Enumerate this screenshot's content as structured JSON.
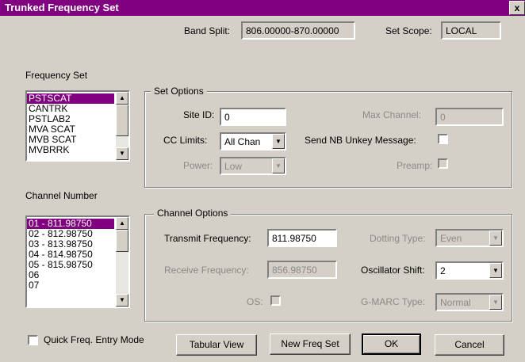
{
  "window": {
    "title": "Trunked Frequency Set",
    "close_glyph": "x"
  },
  "header": {
    "band_split_label": "Band Split:",
    "band_split_value": "806.00000-870.00000",
    "set_scope_label": "Set Scope:",
    "set_scope_value": "LOCAL"
  },
  "frequency_set": {
    "label": "Frequency Set",
    "items": [
      "PSTSCAT",
      "CANTRK",
      "PSTLAB2",
      "MVA SCAT",
      "MVB SCAT",
      "MVBRRK"
    ],
    "selected_index": 0
  },
  "set_options": {
    "label": "Set Options",
    "site_id_label": "Site ID:",
    "site_id_value": "0",
    "max_channel_label": "Max Channel:",
    "max_channel_value": "0",
    "cc_limits_label": "CC Limits:",
    "cc_limits_value": "All Chan",
    "send_nb_unkey_label": "Send NB Unkey Message:",
    "power_label": "Power:",
    "power_value": "Low",
    "preamp_label": "Preamp:"
  },
  "channel_number": {
    "label": "Channel Number",
    "items": [
      "01 - 811.98750",
      "02 - 812.98750",
      "03 - 813.98750",
      "04 - 814.98750",
      "05 - 815.98750",
      "06",
      "07"
    ],
    "selected_index": 0
  },
  "channel_options": {
    "label": "Channel Options",
    "transmit_label": "Transmit Frequency:",
    "transmit_value": "811.98750",
    "dotting_label": "Dotting Type:",
    "dotting_value": "Even",
    "receive_label": "Receive Frequency:",
    "receive_value": "856.98750",
    "oscillator_label": "Oscillator Shift:",
    "oscillator_value": "2",
    "os_label": "OS:",
    "gmarc_label": "G-MARC Type:",
    "gmarc_value": "Normal"
  },
  "footer": {
    "quick_entry_label": "Quick Freq. Entry Mode",
    "tabular_view_label": "Tabular View",
    "new_freq_set_label": "New Freq Set",
    "ok_label": "OK",
    "cancel_label": "Cancel"
  },
  "colors": {
    "accent": "#800080",
    "face": "#d4d0c8",
    "disabled_text": "#8a8a8a"
  },
  "icons": {
    "scroll_up": "up-arrow",
    "scroll_down": "down-arrow",
    "dropdown": "down-arrow",
    "close": "close-x"
  }
}
